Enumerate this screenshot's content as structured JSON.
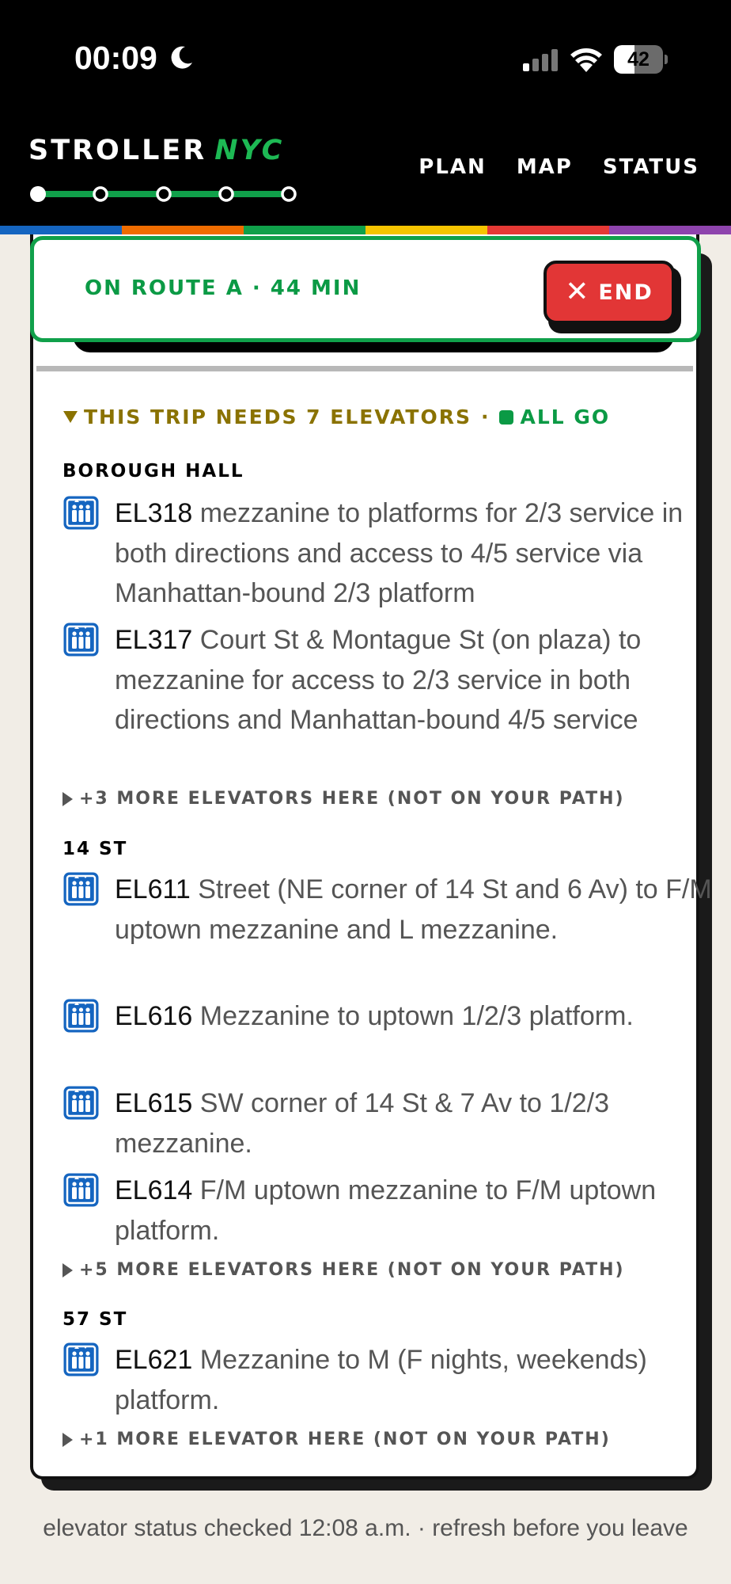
{
  "status_bar": {
    "time": "00:09",
    "battery_level": "42"
  },
  "header": {
    "logo_main": "STROLLER",
    "logo_accent": "NYC",
    "nav": [
      {
        "label": "PLAN"
      },
      {
        "label": "MAP"
      },
      {
        "label": "STATUS"
      }
    ],
    "stripe_colors": [
      "#1565c0",
      "#ef6c00",
      "#10a04a",
      "#f5c400",
      "#e53935",
      "#8e44ad"
    ]
  },
  "route_banner": {
    "text": "ON ROUTE A · 44 MIN",
    "end_label": "END"
  },
  "elevators": {
    "summary": "THIS TRIP NEEDS 7 ELEVATORS",
    "separator": "·",
    "status": "ALL GO",
    "stations": [
      {
        "name": "BOROUGH HALL",
        "items": [
          {
            "code": "EL318",
            "desc": "mezzanine to platforms for 2/3 service in both directions and access to 4/5 service via Manhattan-bound 2/3 platform"
          },
          {
            "code": "EL317",
            "desc": "Court St & Montague St (on plaza) to mezzanine for access to 2/3 service in both directions and Manhattan-bound 4/5 service"
          }
        ],
        "more": "+3 MORE ELEVATORS HERE (NOT ON YOUR PATH)"
      },
      {
        "name": "14 ST",
        "items": [
          {
            "code": "EL611",
            "desc": "Street (NE corner of 14 St and 6 Av) to F/M uptown mezzanine and L mezzanine."
          },
          {
            "code": "EL616",
            "desc": "Mezzanine to uptown 1/2/3 platform."
          },
          {
            "code": "EL615",
            "desc": "SW corner of 14 St & 7 Av to 1/2/3 mezzanine."
          },
          {
            "code": "EL614",
            "desc": "F/M uptown mezzanine to F/M uptown platform."
          }
        ],
        "more": "+5 MORE ELEVATORS HERE (NOT ON YOUR PATH)"
      },
      {
        "name": "57 ST",
        "items": [
          {
            "code": "EL621",
            "desc": "Mezzanine to M (F nights, weekends) platform."
          }
        ],
        "more": "+1 MORE ELEVATOR HERE (NOT ON YOUR PATH)"
      }
    ]
  },
  "footer": {
    "note": "elevator status checked 12:08 a.m. · refresh before you leave"
  }
}
